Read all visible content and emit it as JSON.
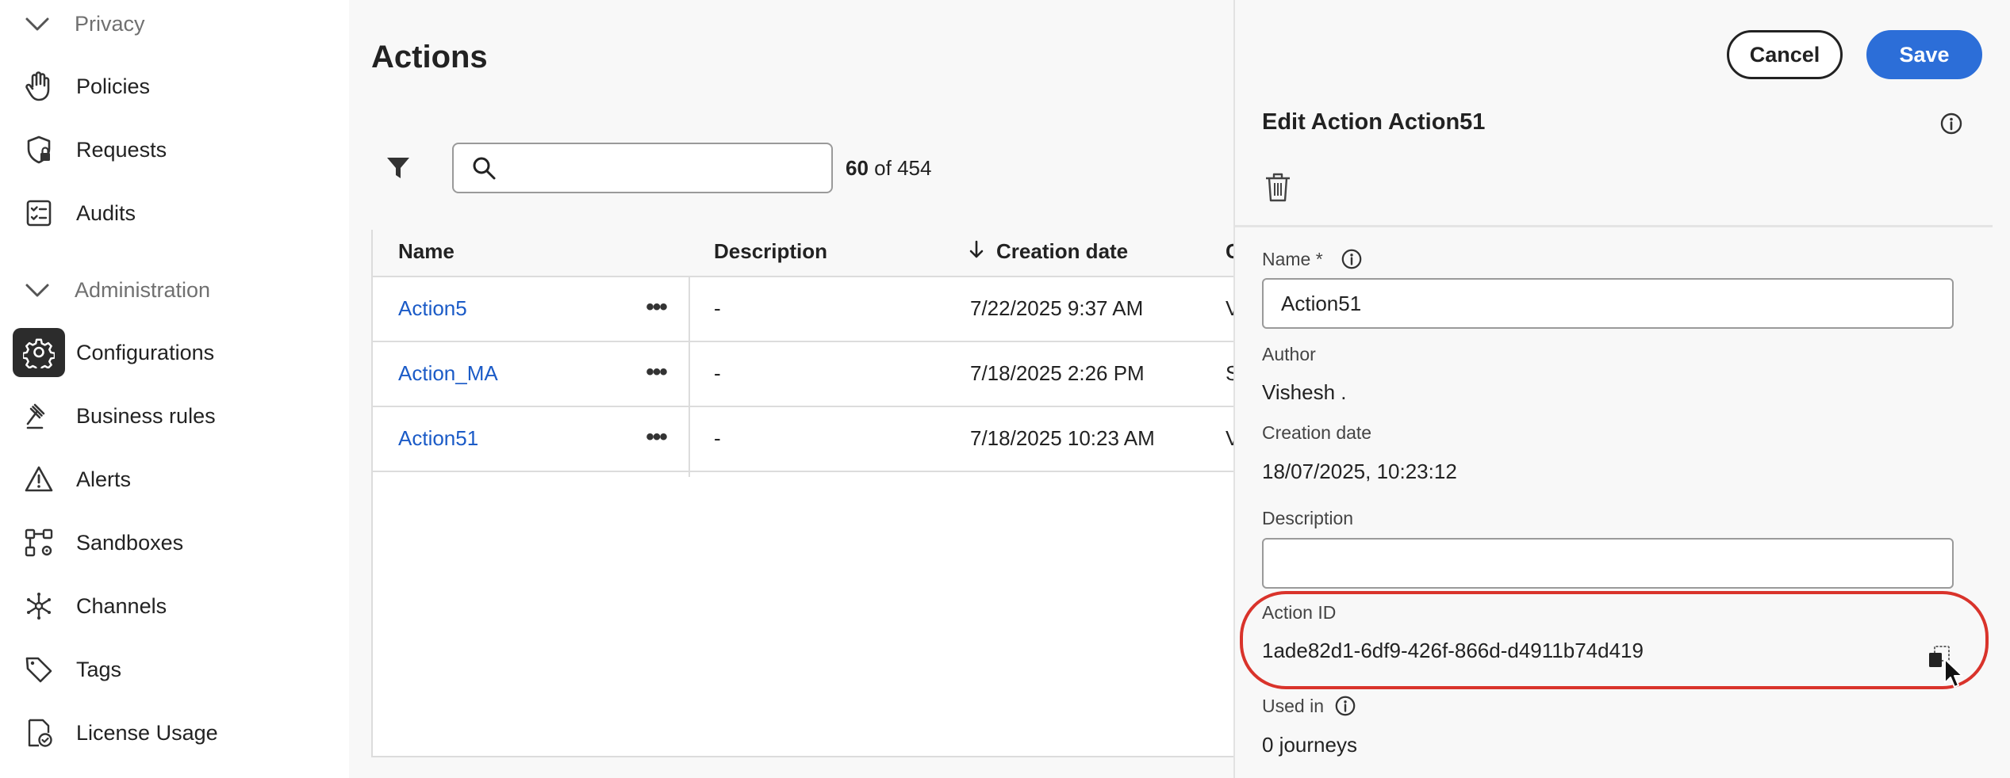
{
  "sidebar": {
    "sections": [
      {
        "label": "Privacy",
        "icon": "chevron-down-icon"
      },
      {
        "label": "Administration",
        "icon": "chevron-down-icon"
      }
    ],
    "items": [
      {
        "label": "Policies",
        "icon": "hand-icon"
      },
      {
        "label": "Requests",
        "icon": "shield-lock-icon"
      },
      {
        "label": "Audits",
        "icon": "checklist-icon"
      },
      {
        "label": "Configurations",
        "icon": "gear-icon",
        "active": true
      },
      {
        "label": "Business rules",
        "icon": "gavel-icon"
      },
      {
        "label": "Alerts",
        "icon": "warning-icon"
      },
      {
        "label": "Sandboxes",
        "icon": "sandbox-icon"
      },
      {
        "label": "Channels",
        "icon": "hub-icon"
      },
      {
        "label": "Tags",
        "icon": "tag-icon"
      },
      {
        "label": "License Usage",
        "icon": "license-icon"
      }
    ]
  },
  "main": {
    "title": "Actions",
    "search": {
      "placeholder": "",
      "value": ""
    },
    "count": {
      "shown": "60",
      "of_text": "of 454"
    },
    "columns": [
      "Name",
      "Description",
      "Creation date",
      "C"
    ],
    "rows": [
      {
        "name": "Action5",
        "description": "-",
        "created": "7/22/2025 9:37 AM",
        "next": "V"
      },
      {
        "name": "Action_MA",
        "description": "-",
        "created": "7/18/2025 2:26 PM",
        "next": "S"
      },
      {
        "name": "Action51",
        "description": "-",
        "created": "7/18/2025 10:23 AM",
        "next": "V"
      }
    ]
  },
  "panel": {
    "cancel_label": "Cancel",
    "save_label": "Save",
    "title": "Edit Action Action51",
    "name_label": "Name",
    "required_mark": "*",
    "name_value": "Action51",
    "author_label": "Author",
    "author_value": "Vishesh .",
    "creation_label": "Creation date",
    "creation_value": "18/07/2025, 10:23:12",
    "description_label": "Description",
    "description_value": "",
    "action_id_label": "Action ID",
    "action_id_value": "1ade82d1-6df9-426f-866d-d4911b74d419",
    "used_in_label": "Used in",
    "used_in_value": "0 journeys"
  },
  "colors": {
    "accent": "#2c6ed8",
    "link": "#1b5bc7",
    "highlight": "#d9332b",
    "active_icon_bg": "#2c2c2c"
  }
}
